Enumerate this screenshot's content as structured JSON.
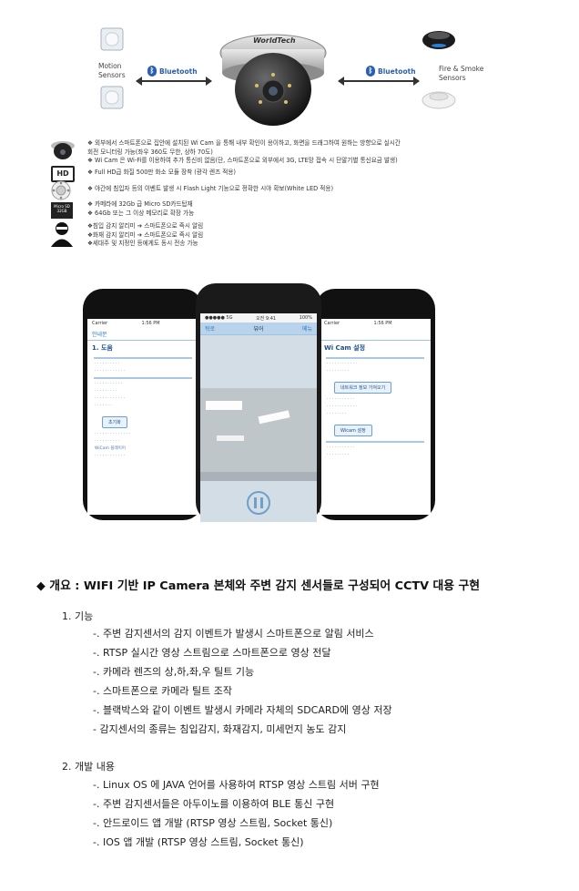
{
  "diagram": {
    "camera_brand": "WorldTech",
    "motion_label": [
      "Motion",
      "Sensors"
    ],
    "fire_label": [
      "Fire & Smoke",
      "Sensors"
    ],
    "bluetooth_left": "Bluetooth",
    "bluetooth_right": "Bluetooth"
  },
  "features": [
    {
      "icon": "dome-camera-icon",
      "lines": [
        "❖ 외부에서 스마트폰으로 집안에 설치된 Wi Cam 을 통해 내부 확인이 용이하고, 화면을 드래그하여 원하는 방향으로 실시간",
        "   회전 모니터링 가능(좌우 360도 무한, 상하 70도)",
        "❖ Wi Cam 은 Wi-Fi를 이용하여 추가 통신비 없음(단, 스마트폰으로 외부에서 3G, LTE망 접속 시 단말기별 통신요금 발생)"
      ]
    },
    {
      "icon": "hd-icon",
      "lines": [
        "❖ Full HD급 화질 500만 화소 모듈 장착 (광각 렌즈 적용)"
      ]
    },
    {
      "icon": "led-ring-icon",
      "lines": [
        "❖ 야간에 침입자 등의 이벤트 발생 시 Flash Light 기능으로 정확한 시야 확보(White LED 적용)"
      ]
    },
    {
      "icon": "micro-sd-icon",
      "lines": [
        "❖ 카메라에 32Gb 급 Micro SD카드탑재",
        "❖ 64Gb 또는 그 이상 메모리로 확장 가능"
      ]
    },
    {
      "icon": "intruder-icon",
      "lines": [
        "❖침입 감지 알리미 ➔ 스마트폰으로 즉시 알림",
        "❖화재 감지 알리미 ➔ 스마트폰으로 즉시 알림",
        "❖세대주 및 지정인 등에게도 동시 전송 가능"
      ]
    }
  ],
  "sd_label": "Micro SD\n32GB",
  "hd_label": "HD",
  "phones": {
    "left": {
      "carrier": "Carrier",
      "time": "1:56 PM",
      "nav": "안내문",
      "title": "1. 도움",
      "button": "초기화",
      "section2": "WiCam 플레이어"
    },
    "center": {
      "carrier": "●●●●● 5G",
      "time": "오전 9:41",
      "battery": "100%",
      "nav_left": "뒤로",
      "nav_title": "뷰어",
      "nav_right": "메뉴"
    },
    "right": {
      "carrier": "Carrier",
      "time": "1:56 PM",
      "title": "Wi Cam 설정",
      "button1": "네트워크 정보 가져오기",
      "button2": "Wicam 설정"
    }
  },
  "heading": "◆ 개요 : WIFI 기반 IP Camera 본체와 주변 감지 센서들로 구성되어 CCTV 대용 구현",
  "section1": {
    "title": "1. 기능",
    "items": [
      "-. 주변 감지센서의 감지 이벤트가 발생시 스마트폰으로 알림 서비스",
      "-. RTSP 실시간 영상 스트림으로 스마트폰으로 영상 전달",
      "-. 카메라 렌즈의 상,하,좌,우 틸트 기능",
      "-. 스마트폰으로 카메라 틸트 조작",
      "-. 블랙박스와 같이 이벤트 발생시 카메라 자체의 SDCARD에 영상 저장",
      "- 감지센서의 종류는 침입감지, 화재감지, 미세먼지 농도 감지"
    ]
  },
  "section2": {
    "title": "2. 개발 내용",
    "items": [
      "-. Linux OS 에 JAVA 언어를 사용하여 RTSP 영상 스트림 서버 구현",
      "-. 주변 감지센서들은 아두이노를 이용하여 BLE 통신 구현",
      "-. 안드로이드 앱 개발 (RTSP 영상 스트림, Socket 통신)",
      "-. IOS 앱 개발 (RTSP 영상 스트림, Socket 통신)"
    ]
  }
}
